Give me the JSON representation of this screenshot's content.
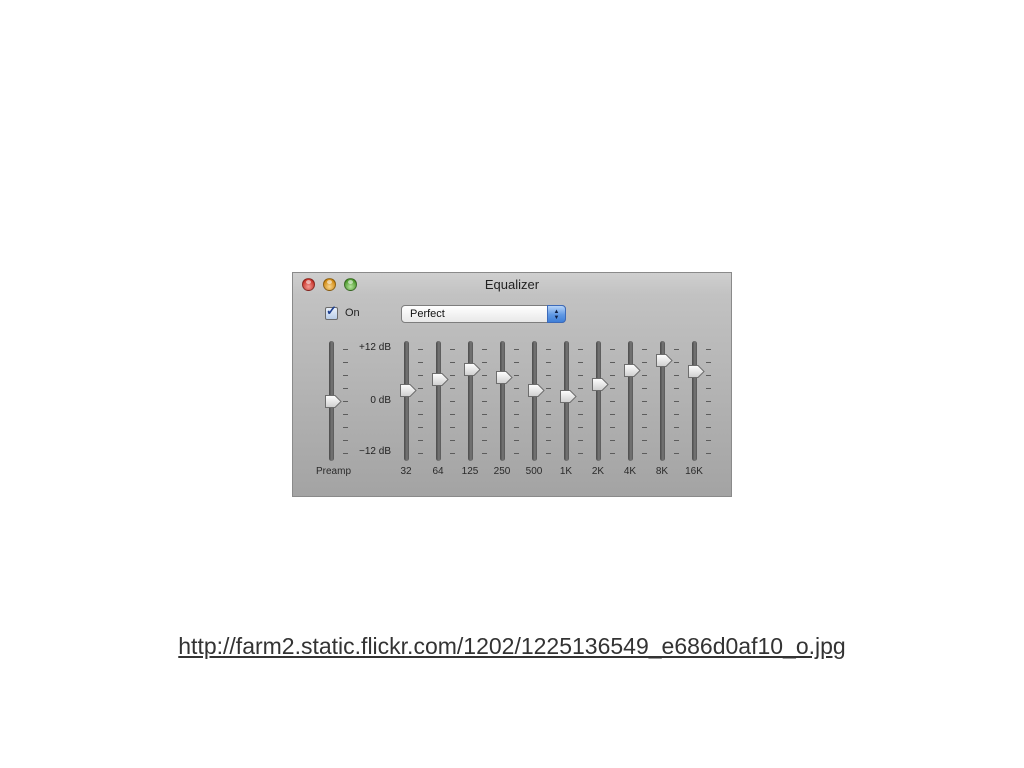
{
  "window": {
    "title": "Equalizer",
    "buttons": [
      "close",
      "minimize",
      "zoom"
    ]
  },
  "on_toggle": {
    "label": "On",
    "checked": true
  },
  "preset": {
    "value": "Perfect"
  },
  "scale": {
    "top": "+12 dB",
    "middle": "0 dB",
    "bottom": "−12 dB"
  },
  "preamp": {
    "label": "Preamp",
    "level_db": 0
  },
  "bands": [
    {
      "label": "32",
      "level_db": 2.5
    },
    {
      "label": "64",
      "level_db": 5
    },
    {
      "label": "125",
      "level_db": 7.5
    },
    {
      "label": "250",
      "level_db": 5.5
    },
    {
      "label": "500",
      "level_db": 2.5
    },
    {
      "label": "1K",
      "level_db": 1.2
    },
    {
      "label": "2K",
      "level_db": 4
    },
    {
      "label": "4K",
      "level_db": 7.2
    },
    {
      "label": "8K",
      "level_db": 9.5
    },
    {
      "label": "16K",
      "level_db": 7
    }
  ],
  "caption": {
    "text": "http://farm2.static.flickr.com/1202/1225136549_e686d0af10_o.jpg"
  }
}
